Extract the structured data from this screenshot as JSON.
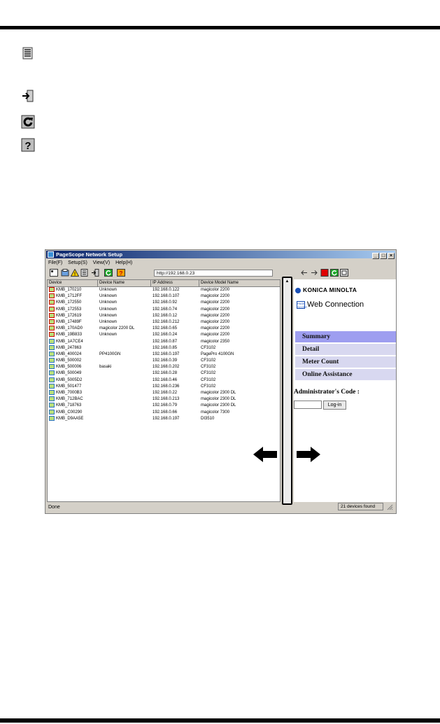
{
  "app_window": {
    "title": "PageScope Network Setup",
    "win_buttons": [
      "_",
      "□",
      "×"
    ],
    "menu": [
      "File(F)",
      "Setup(S)",
      "View(V)",
      "Help(H)"
    ],
    "address": "http://192.168.0.23",
    "columns": [
      "Device",
      "Device Name",
      "IP Address",
      "Device Model Name"
    ],
    "devices": [
      {
        "device": "KMB_170210",
        "name": "Unknown",
        "ip": "192.168.0.122",
        "model": "magicolor 2200",
        "warn": true
      },
      {
        "device": "KMB_1712FF",
        "name": "Unknown",
        "ip": "192.168.0.107",
        "model": "magicolor 2200",
        "warn": true
      },
      {
        "device": "KMB_172550",
        "name": "Unknown",
        "ip": "192.168.0.92",
        "model": "magicolor 2200",
        "warn": true
      },
      {
        "device": "KMB_172553",
        "name": "Unknown",
        "ip": "192.168.0.74",
        "model": "magicolor 2200",
        "warn": true
      },
      {
        "device": "KMB_172619",
        "name": "Unknown",
        "ip": "192.168.0.12",
        "model": "magicolor 2200",
        "warn": true
      },
      {
        "device": "KMB_17489F",
        "name": "Unknown",
        "ip": "192.168.0.212",
        "model": "magicolor 2200",
        "warn": true
      },
      {
        "device": "KMB_170AD0",
        "name": "magicolor 2200 DL",
        "ip": "192.168.0.65",
        "model": "magicolor 2200",
        "warn": true
      },
      {
        "device": "KMB_19B833",
        "name": "Unknown",
        "ip": "192.168.0.24",
        "model": "magicolor 2200",
        "warn": true
      },
      {
        "device": "KMB_1A7CE4",
        "name": "",
        "ip": "192.168.0.87",
        "model": "magicolor 2350",
        "warn": false
      },
      {
        "device": "KMB_247863",
        "name": "",
        "ip": "192.168.0.85",
        "model": "CF3102",
        "warn": false
      },
      {
        "device": "KMB_400024",
        "name": "PP4100GN",
        "ip": "192.168.0.197",
        "model": "PagePro 4100GN",
        "warn": false
      },
      {
        "device": "KMB_500002",
        "name": "",
        "ip": "192.168.0.39",
        "model": "CF3102",
        "warn": false
      },
      {
        "device": "KMB_500006",
        "name": "basaki",
        "ip": "192.168.0.202",
        "model": "CF3102",
        "warn": false
      },
      {
        "device": "KMB_500049",
        "name": "",
        "ip": "192.168.0.28",
        "model": "CF3102",
        "warn": false
      },
      {
        "device": "KMB_5005D2",
        "name": "",
        "ip": "192.168.0.46",
        "model": "CF3102",
        "warn": false
      },
      {
        "device": "KMB_501477",
        "name": "",
        "ip": "192.168.0.236",
        "model": "CF3102",
        "warn": false
      },
      {
        "device": "KMB_7000B3",
        "name": "",
        "ip": "192.168.0.22",
        "model": "magicolor 2300 DL",
        "warn": false
      },
      {
        "device": "KMB_712BAC",
        "name": "",
        "ip": "192.168.0.213",
        "model": "magicolor 2300 DL",
        "warn": false
      },
      {
        "device": "KMB_718763",
        "name": "",
        "ip": "192.168.0.79",
        "model": "magicolor 2300 DL",
        "warn": false
      },
      {
        "device": "KMB_C00290",
        "name": "",
        "ip": "192.168.0.66",
        "model": "magicolor 7300",
        "warn": false
      },
      {
        "device": "KMB_D9AA5E",
        "name": "",
        "ip": "192.168.0.197",
        "model": "DI3510",
        "warn": false
      }
    ],
    "web": {
      "brand": "KONICA MINOLTA",
      "badge": "PAGE SCOPE",
      "product": "Web Connection",
      "menu": [
        "Summary",
        "Detail",
        "Meter Count",
        "Online Assistance"
      ],
      "admin_label": "Administrator's Code :",
      "login": "Log-in"
    },
    "status_left": "Done",
    "status_right": "21 devices found"
  },
  "colors": {
    "menu_active": "#9e9ef0",
    "menu_item": "#d8d8f0",
    "brand_blue": "#1a4fb5",
    "warn_red": "#d00000"
  },
  "icons": [
    "list-icon",
    "exit-icon",
    "refresh-icon",
    "help-icon"
  ]
}
